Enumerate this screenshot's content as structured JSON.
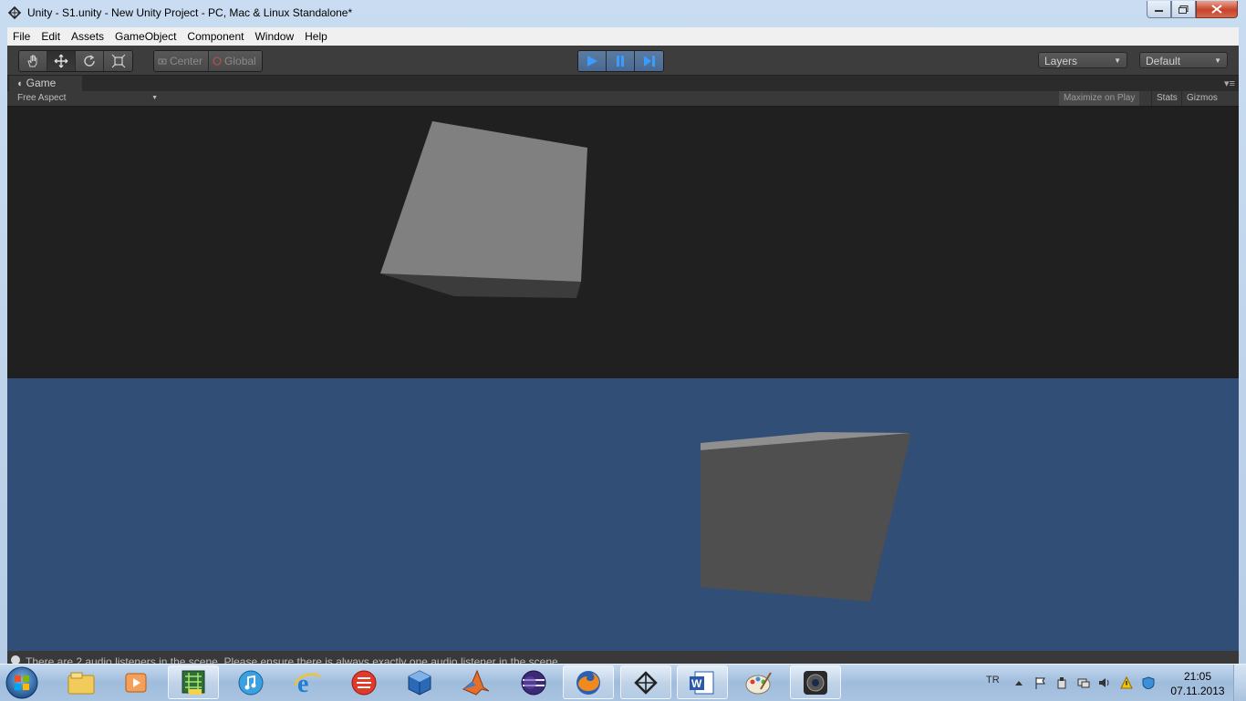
{
  "window": {
    "title": "Unity - S1.unity - New Unity Project - PC, Mac & Linux Standalone*",
    "app_icon": "unity-icon"
  },
  "menubar": {
    "items": [
      "File",
      "Edit",
      "Assets",
      "GameObject",
      "Component",
      "Window",
      "Help"
    ]
  },
  "toolbar": {
    "tools": [
      {
        "icon": "hand-icon",
        "active": false
      },
      {
        "icon": "move-icon",
        "active": true
      },
      {
        "icon": "rotate-icon",
        "active": false
      },
      {
        "icon": "scale-icon",
        "active": false
      }
    ],
    "pivot_mode": "Center",
    "pivot_rotation": "Global",
    "playback": {
      "play_active": true,
      "pause_active": true,
      "step_active": true
    },
    "layers_label": "Layers",
    "layout_label": "Default"
  },
  "game_panel": {
    "tab_label": "Game",
    "aspect": "Free Aspect",
    "maximize_label": "Maximize on Play",
    "stats_label": "Stats",
    "gizmos_label": "Gizmos",
    "colors": {
      "top_bg": "#202020",
      "bottom_bg": "#314e76",
      "cube_face": "#808080"
    }
  },
  "status": {
    "message": "There are 2 audio listeners in the scene. Please ensure there is always exactly one audio listener in the scene."
  },
  "taskbar": {
    "apps": [
      {
        "icon": "file-explorer-icon",
        "pinned": false
      },
      {
        "icon": "media-player-icon",
        "pinned": false
      },
      {
        "icon": "circuit-tool-icon",
        "pinned": true
      },
      {
        "icon": "itunes-icon",
        "pinned": false
      },
      {
        "icon": "internet-explorer-icon",
        "pinned": false
      },
      {
        "icon": "red-app-icon",
        "pinned": false
      },
      {
        "icon": "virtualbox-icon",
        "pinned": false
      },
      {
        "icon": "matlab-icon",
        "pinned": false
      },
      {
        "icon": "eclipse-icon",
        "pinned": false
      },
      {
        "icon": "firefox-icon",
        "pinned": true
      },
      {
        "icon": "unity-icon",
        "pinned": true
      },
      {
        "icon": "word-icon",
        "pinned": true
      },
      {
        "icon": "paint-icon",
        "pinned": false
      },
      {
        "icon": "camera-app-icon",
        "pinned": true
      }
    ],
    "language": "TR",
    "time": "21:05",
    "date": "07.11.2013"
  }
}
